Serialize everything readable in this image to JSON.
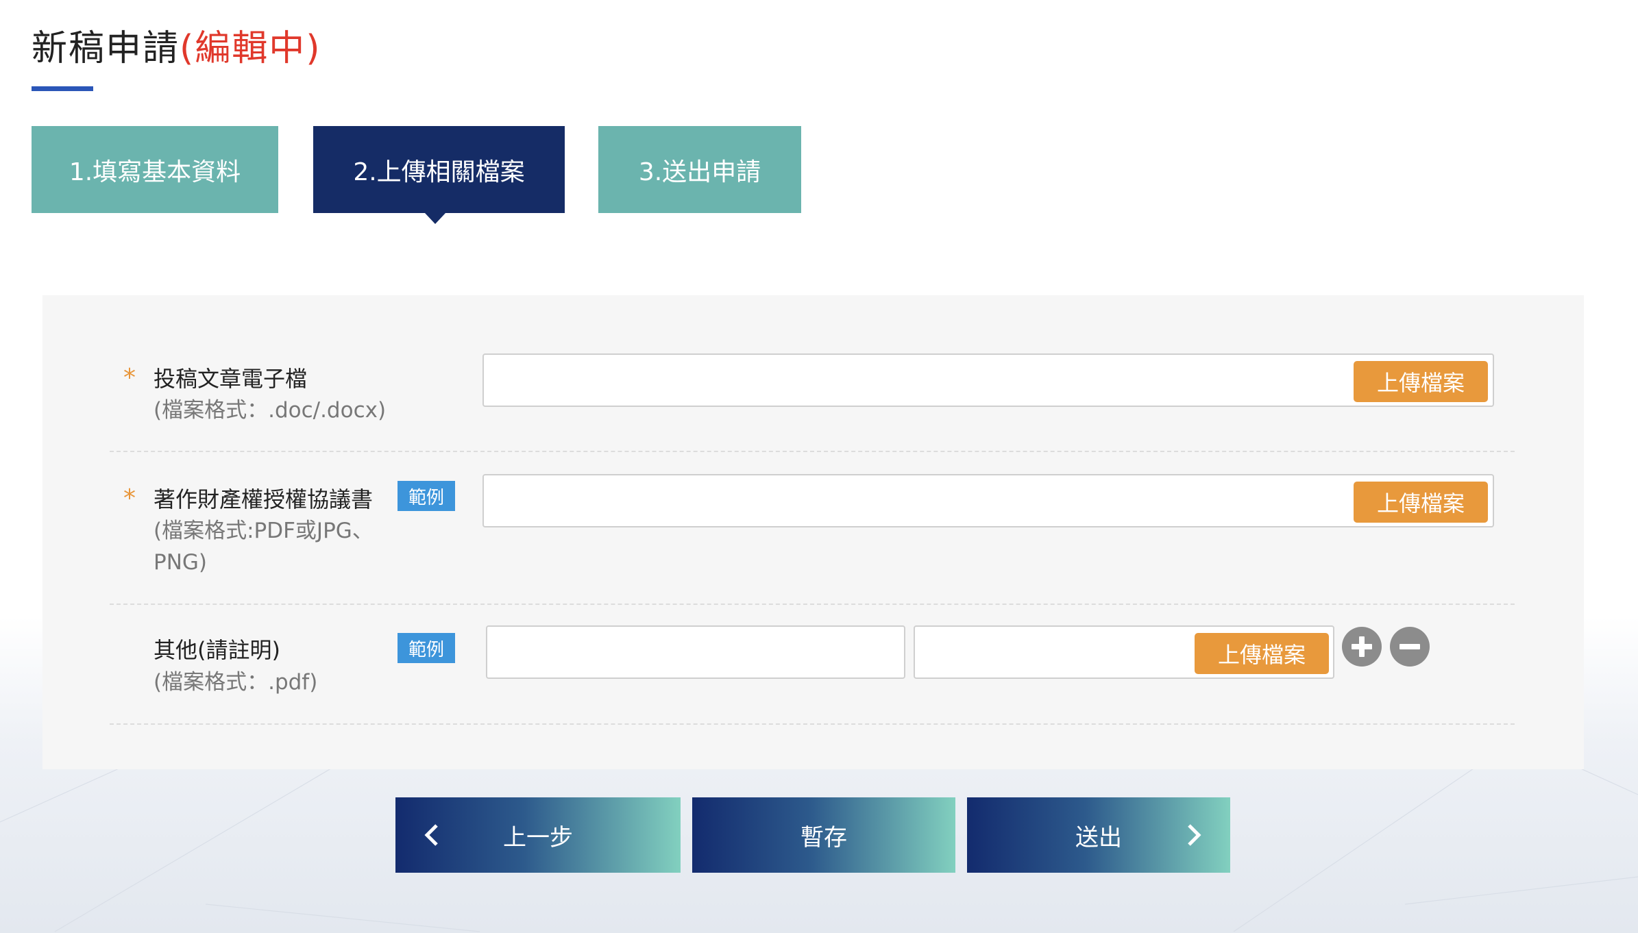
{
  "header": {
    "title": "新稿申請",
    "status": "(編輯中)"
  },
  "steps": [
    {
      "label": "1.填寫基本資料",
      "active": false
    },
    {
      "label": "2.上傳相關檔案",
      "active": true
    },
    {
      "label": "3.送出申請",
      "active": false
    }
  ],
  "form": {
    "required_mark": "*",
    "example_label": "範例",
    "upload_label": "上傳檔案",
    "rows": [
      {
        "label": "投稿文章電子檔",
        "hint_lines": [
          "(檔案格式：.doc/.docx)"
        ],
        "required": true,
        "has_example": false,
        "file_value": ""
      },
      {
        "label": "著作財產權授權協議書",
        "hint_lines": [
          "(檔案格式:PDF或JPG、",
          "PNG)"
        ],
        "required": true,
        "has_example": true,
        "file_value": ""
      },
      {
        "label": "其他(請註明)",
        "hint_lines": [
          "(檔案格式：.pdf)"
        ],
        "required": false,
        "has_example": true,
        "note_value": "",
        "file_value": ""
      }
    ]
  },
  "icons": {
    "add": "plus-circle-icon",
    "remove": "minus-circle-icon",
    "prev": "chevron-left-icon",
    "next": "chevron-right-icon"
  },
  "colors": {
    "active_step": "#152c66",
    "inactive_step": "#6bb4ae",
    "title_status": "#e0382b",
    "required_star": "#e8963a",
    "upload_button": "#e8993c",
    "example_badge": "#3d95db"
  },
  "nav": {
    "prev_label": "上一步",
    "save_label": "暫存",
    "submit_label": "送出"
  }
}
